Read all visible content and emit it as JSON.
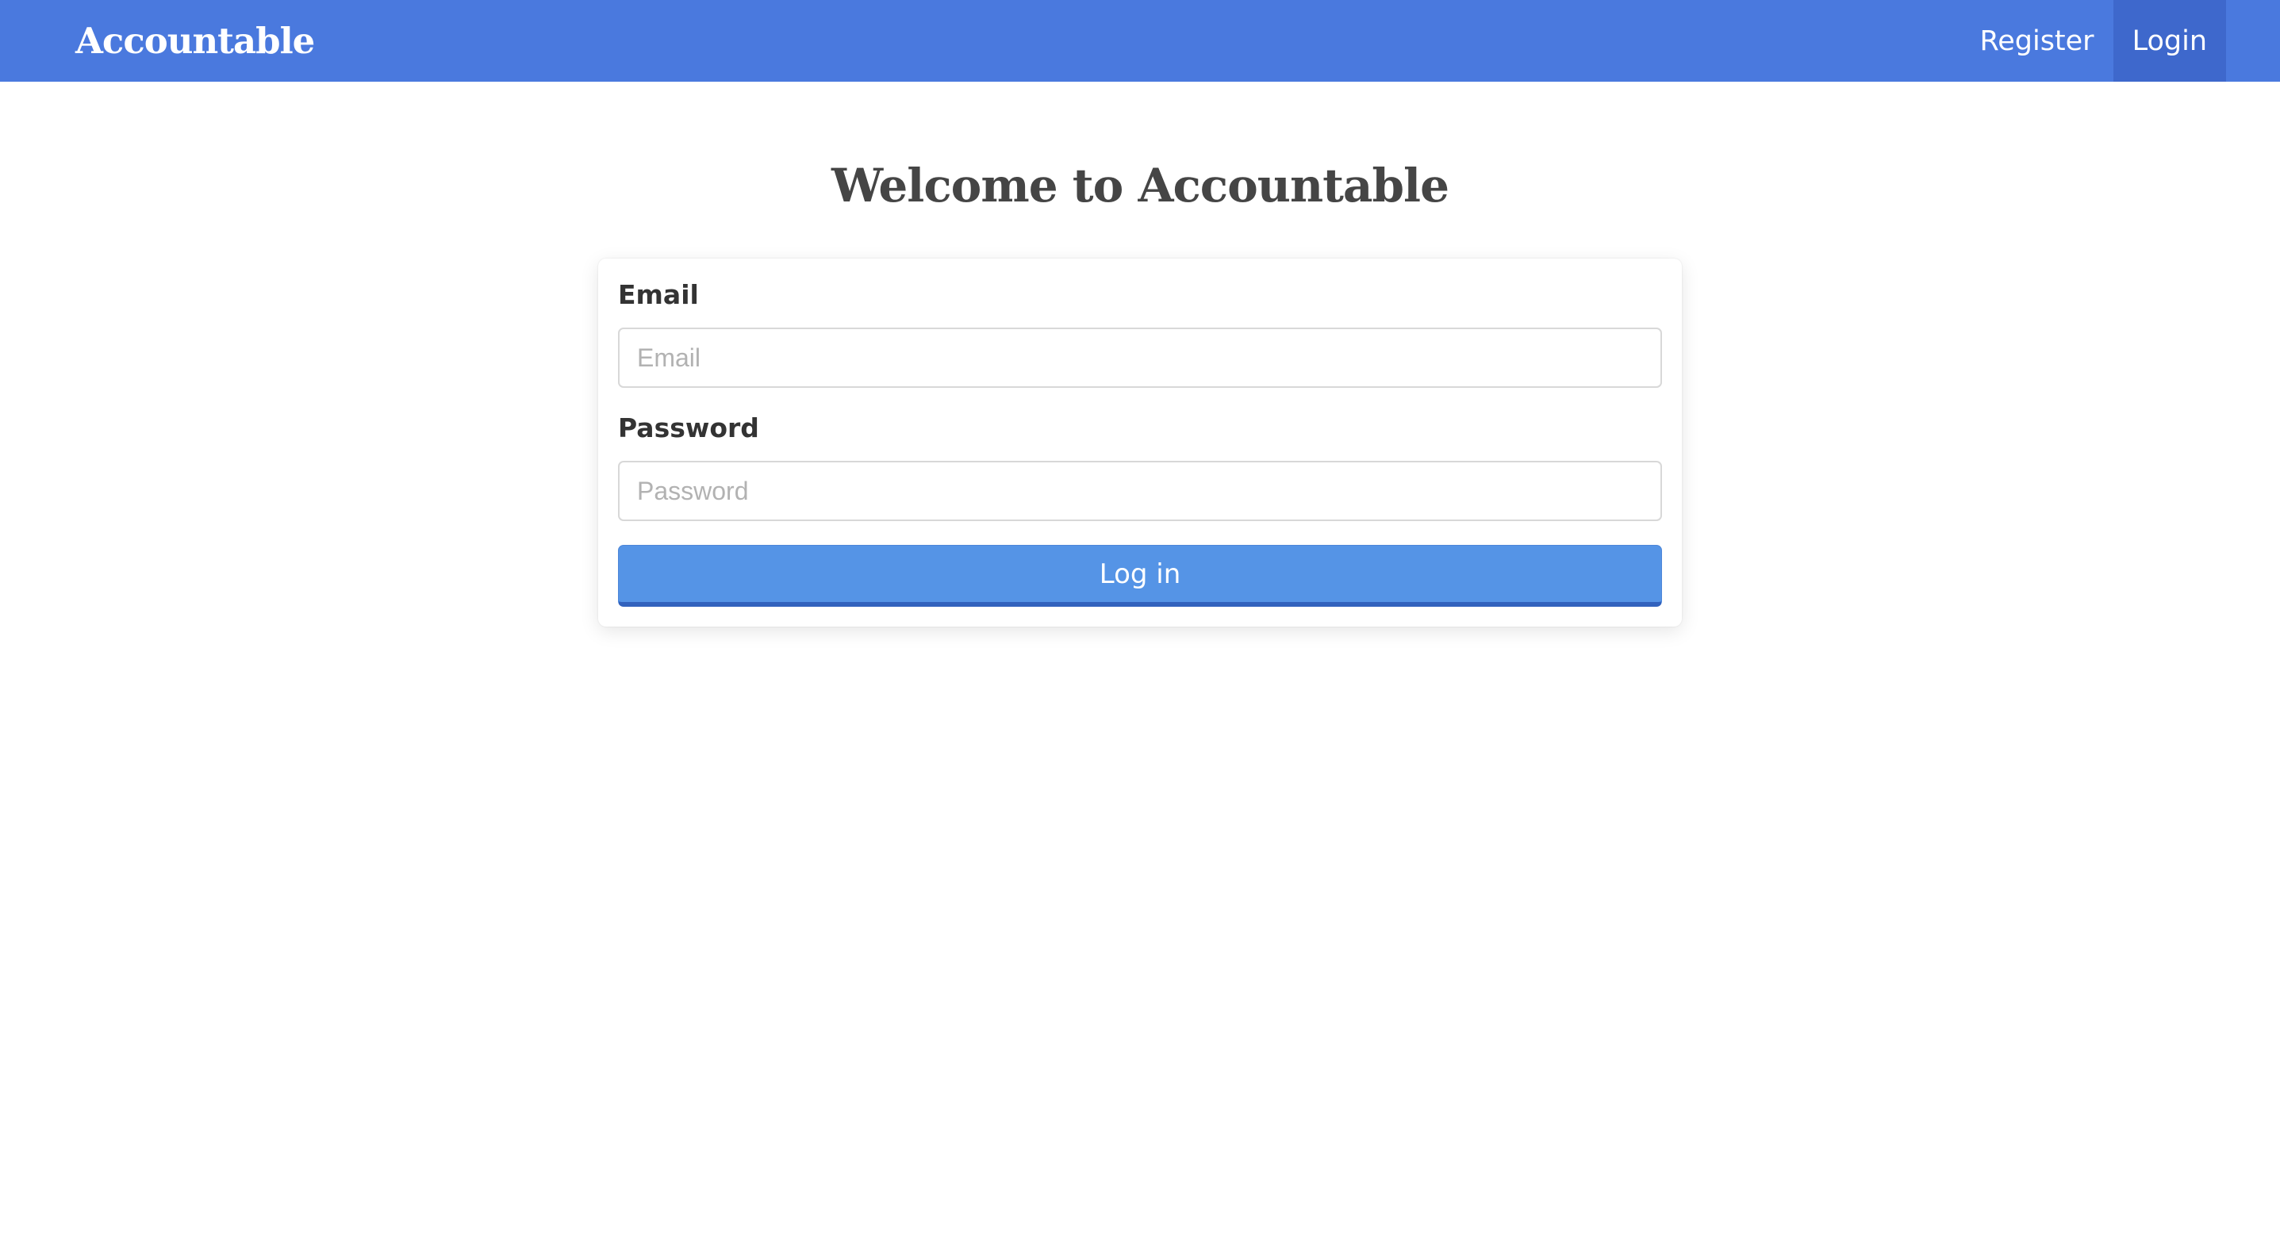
{
  "navbar": {
    "brand": "Accountable",
    "links": [
      {
        "label": "Register"
      },
      {
        "label": "Login"
      }
    ]
  },
  "page": {
    "title": "Welcome to Accountable"
  },
  "form": {
    "email_label": "Email",
    "email_placeholder": "Email",
    "email_value": "",
    "password_label": "Password",
    "password_placeholder": "Password",
    "password_value": "",
    "submit_label": "Log in"
  },
  "colors": {
    "navbar_bg": "#4a79de",
    "active_nav_bg": "#3e68cc",
    "button_bg": "#5594e6",
    "button_border_bottom": "#3262bd"
  }
}
